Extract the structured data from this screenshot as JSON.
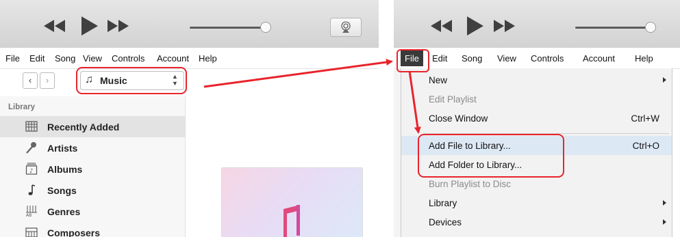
{
  "left": {
    "menu": [
      "File",
      "Edit",
      "Song",
      "View",
      "Controls",
      "Account",
      "Help"
    ],
    "media_picker": {
      "value": "Music"
    },
    "library_label": "Library",
    "sidebar": [
      {
        "label": "Recently Added",
        "icon": "grid-icon",
        "selected": true
      },
      {
        "label": "Artists",
        "icon": "microphone-icon"
      },
      {
        "label": "Albums",
        "icon": "album-icon"
      },
      {
        "label": "Songs",
        "icon": "music-note-icon"
      },
      {
        "label": "Genres",
        "icon": "genres-icon"
      },
      {
        "label": "Composers",
        "icon": "piano-icon"
      }
    ]
  },
  "right": {
    "menu": [
      "File",
      "Edit",
      "Song",
      "View",
      "Controls",
      "Account",
      "Help"
    ],
    "file_menu": [
      {
        "label": "New",
        "shortcut": "",
        "submenu": true,
        "enabled": true
      },
      {
        "label": "Edit Playlist",
        "shortcut": "",
        "submenu": false,
        "enabled": false
      },
      {
        "label": "Close Window",
        "shortcut": "Ctrl+W",
        "submenu": false,
        "enabled": true
      },
      {
        "label": "Add File to Library...",
        "shortcut": "Ctrl+O",
        "submenu": false,
        "enabled": true,
        "highlighted": true
      },
      {
        "label": "Add Folder to Library...",
        "shortcut": "",
        "submenu": false,
        "enabled": true,
        "highlighted": true
      },
      {
        "label": "Burn Playlist to Disc",
        "shortcut": "",
        "submenu": false,
        "enabled": false
      },
      {
        "label": "Library",
        "shortcut": "",
        "submenu": true,
        "enabled": true
      },
      {
        "label": "Devices",
        "shortcut": "",
        "submenu": true,
        "enabled": true
      }
    ]
  },
  "colors": {
    "annotation": "#e8232b",
    "selected_row": "#e3e3e3",
    "file_menu_active": "#3a3a3a"
  }
}
